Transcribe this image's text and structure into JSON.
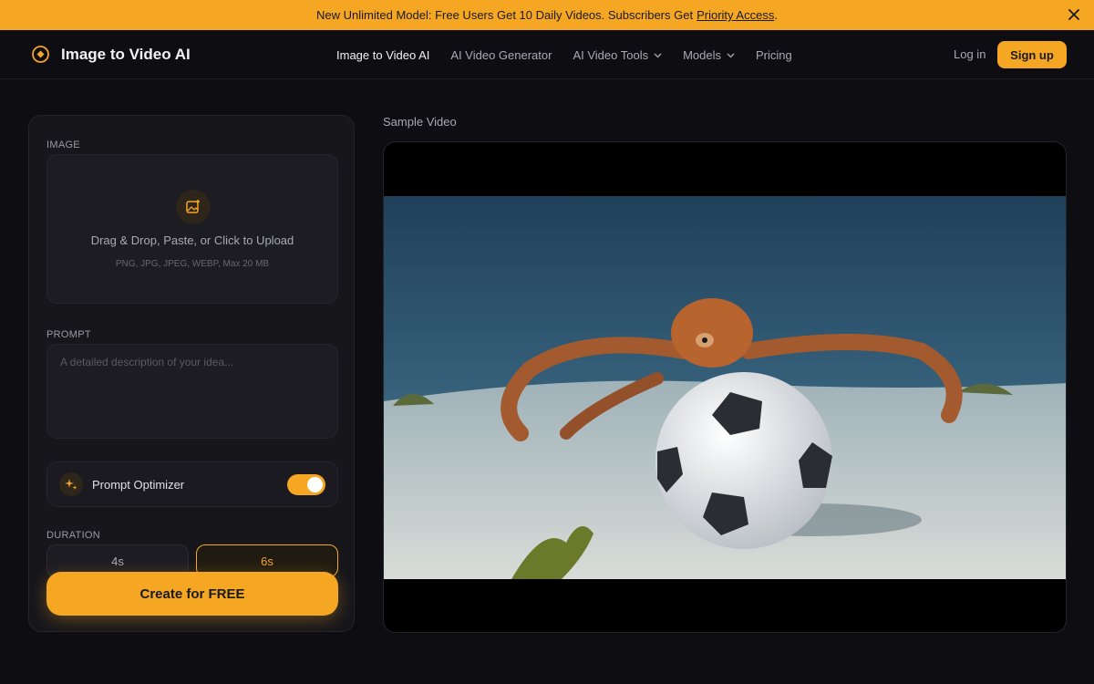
{
  "banner": {
    "text": "New Unlimited Model: Free Users Get 10 Daily Videos. Subscribers Get",
    "link": "Priority Access",
    "suffix": "."
  },
  "header": {
    "brand": "Image to Video AI",
    "nav": [
      {
        "label": "Image to Video AI",
        "active": true
      },
      {
        "label": "AI Video Generator"
      },
      {
        "label": "AI Video Tools",
        "dropdown": true
      },
      {
        "label": "Models",
        "dropdown": true
      },
      {
        "label": "Pricing"
      }
    ],
    "login": "Log in",
    "signup": "Sign up"
  },
  "form": {
    "image_label": "IMAGE",
    "upload_title": "Drag & Drop, Paste, or Click to Upload",
    "upload_sub": "PNG, JPG, JPEG, WEBP, Max 20 MB",
    "prompt_label": "PROMPT",
    "prompt_placeholder": "A detailed description of your idea...",
    "optimizer_label": "Prompt Optimizer",
    "optimizer_on": true,
    "duration_label": "DURATION",
    "durations": [
      "4s",
      "6s"
    ],
    "selected_duration": "6s",
    "create": "Create for FREE"
  },
  "preview": {
    "label": "Sample Video"
  },
  "colors": {
    "accent": "#f5a623",
    "background": "#0e0e12",
    "panel": "#16161b"
  }
}
